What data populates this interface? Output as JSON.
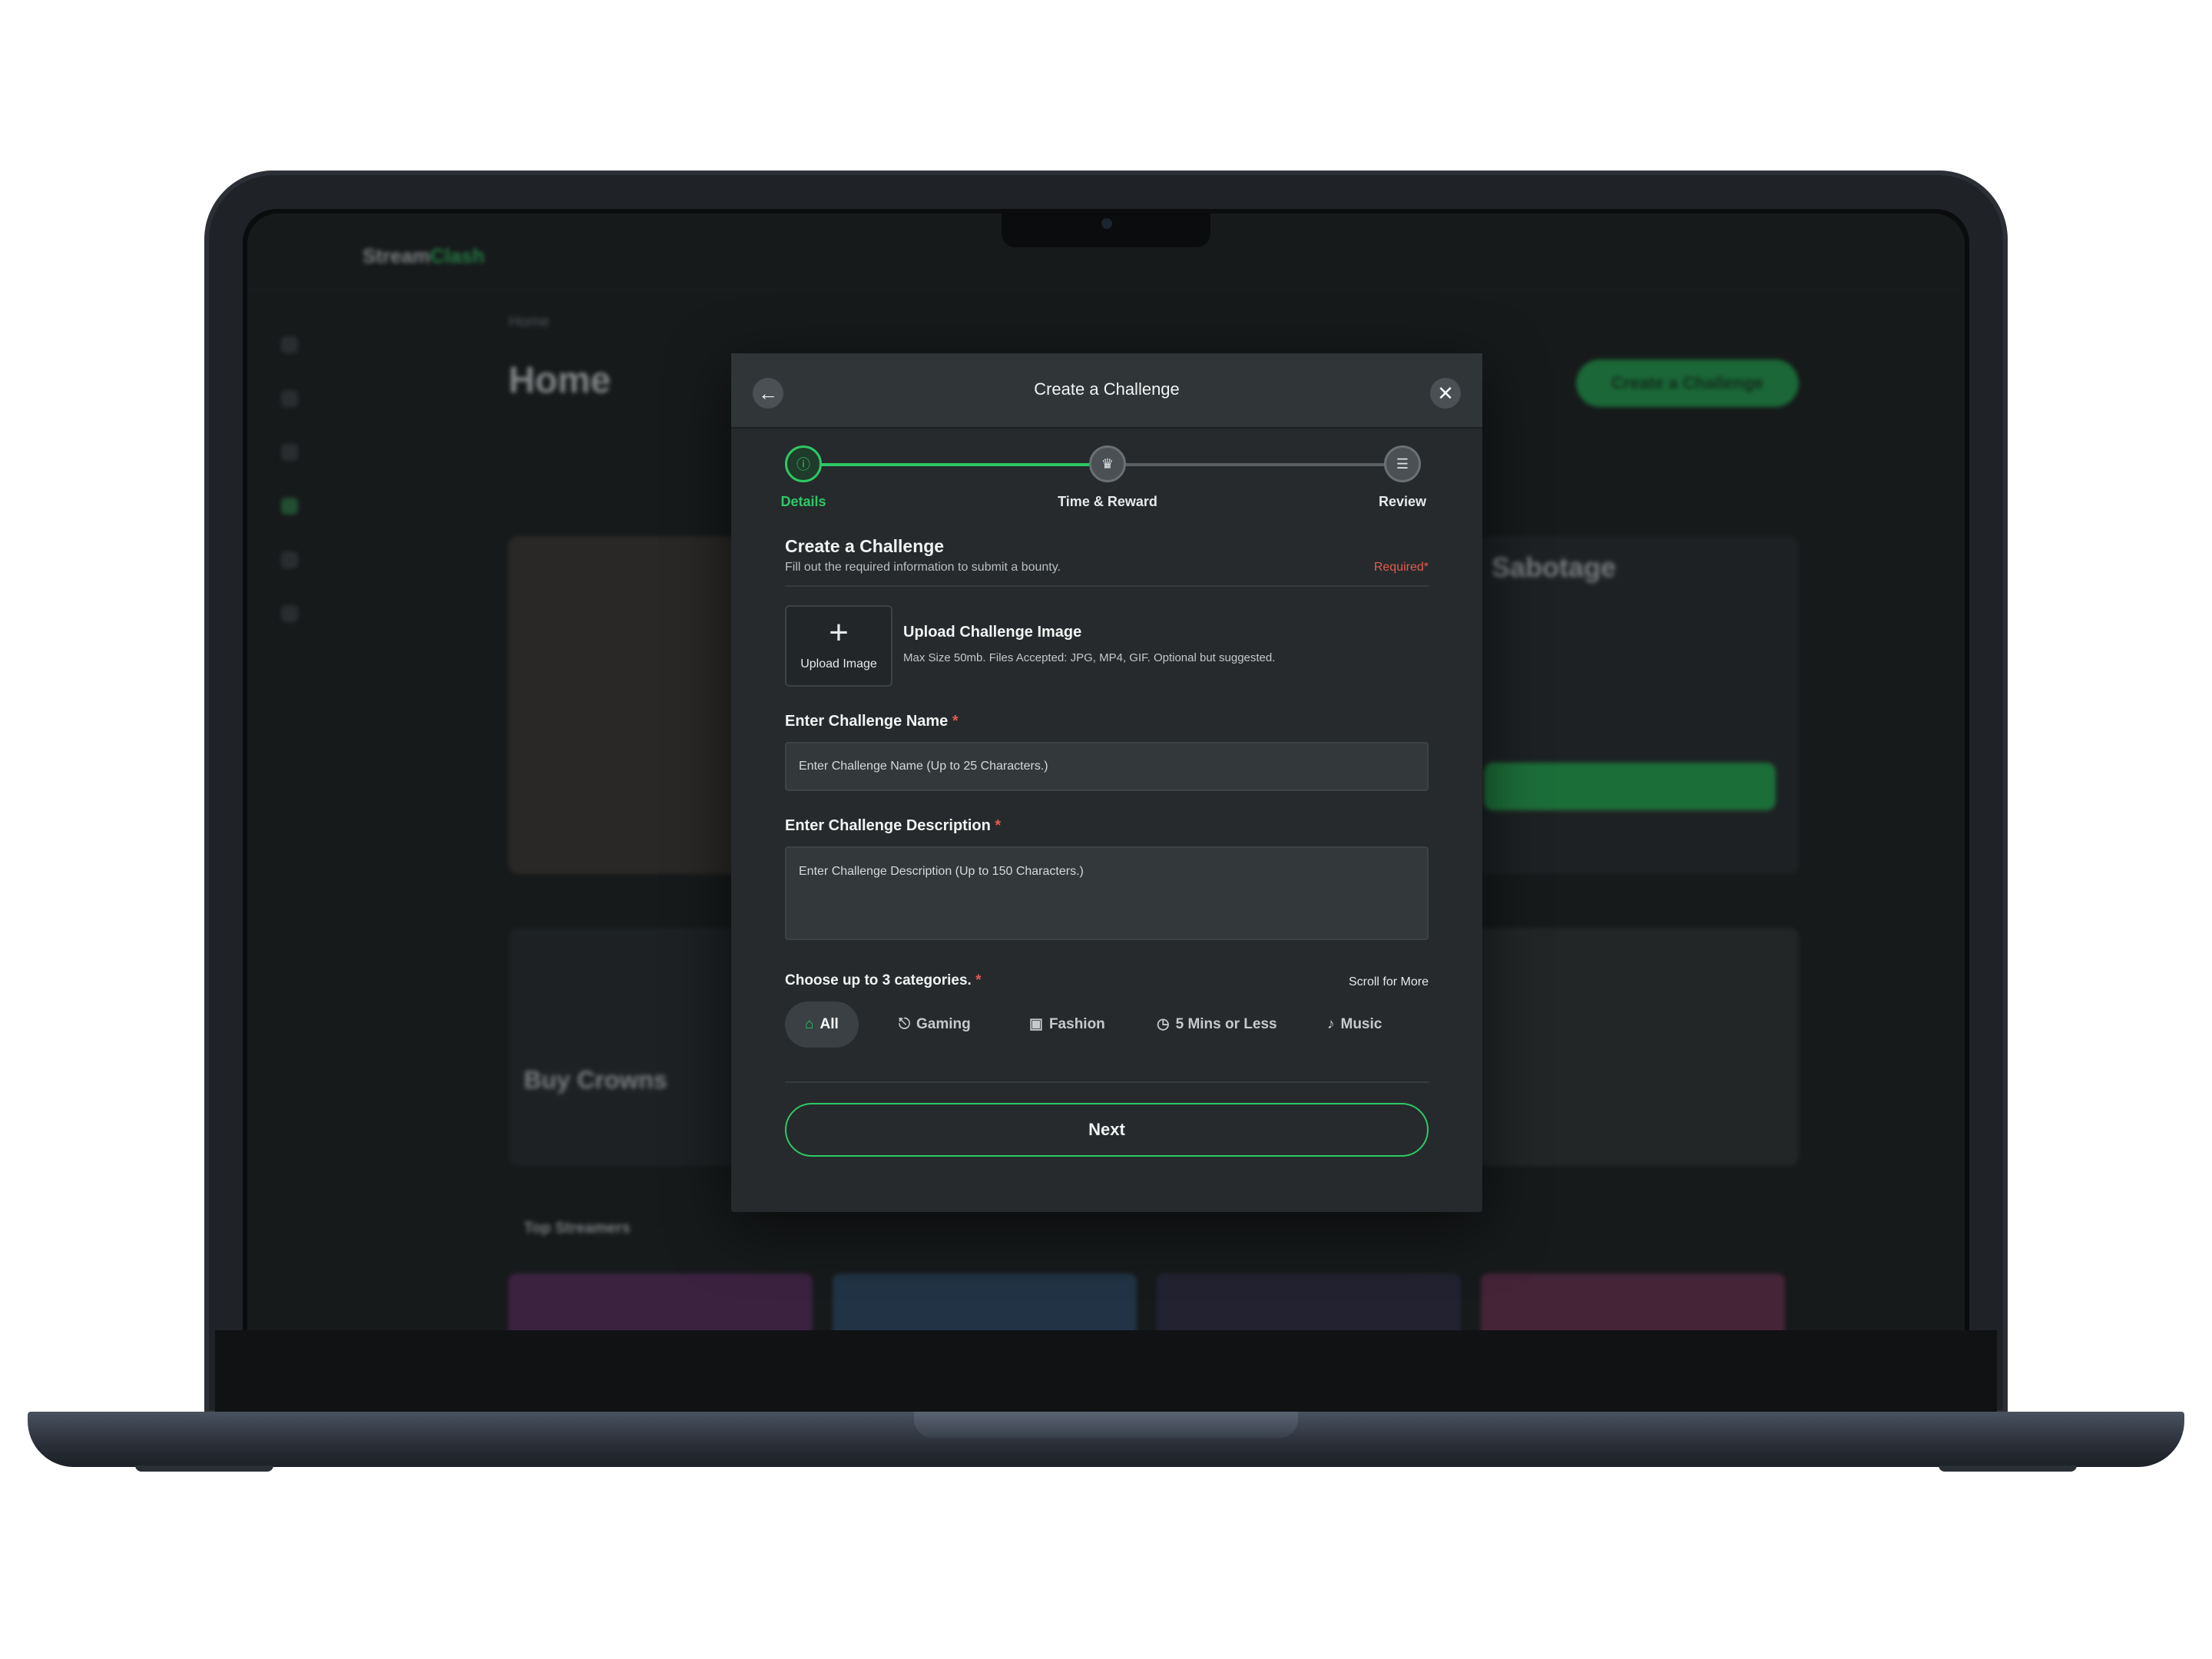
{
  "background_app": {
    "logo_prefix": "Stream",
    "logo_suffix": "Clash",
    "breadcrumb": "Home",
    "page_title": "Home",
    "create_button": "Create a Challenge",
    "featured_title": "Sabotage",
    "promo_title": "Buy Crowns",
    "section_top_streamers": "Top Streamers"
  },
  "modal": {
    "title": "Create a Challenge",
    "steps": [
      {
        "label": "Details",
        "state": "active"
      },
      {
        "label": "Time & Reward",
        "state": "inactive"
      },
      {
        "label": "Review",
        "state": "inactive"
      }
    ],
    "section_title": "Create a Challenge",
    "section_subtitle": "Fill out the required information to submit a bounty.",
    "required_note": "Required*",
    "upload": {
      "button_label": "Upload Image",
      "title": "Upload Challenge Image",
      "hint": "Max Size 50mb. Files Accepted: JPG, MP4, GIF. Optional but suggested."
    },
    "name_field": {
      "label": "Enter Challenge Name",
      "required_mark": "*",
      "placeholder": "Enter Challenge Name (Up to 25 Characters.)"
    },
    "description_field": {
      "label": "Enter Challenge Description",
      "required_mark": "*",
      "placeholder": "Enter Challenge Description (Up to 150 Characters.)"
    },
    "categories": {
      "label": "Choose up to 3 categories.",
      "required_mark": "*",
      "scroll_hint": "Scroll for More",
      "items": [
        {
          "label": "All",
          "icon": "home-icon",
          "active": true
        },
        {
          "label": "Gaming",
          "icon": "gamepad-icon",
          "active": false
        },
        {
          "label": "Fashion",
          "icon": "shirt-icon",
          "active": false
        },
        {
          "label": "5 Mins or Less",
          "icon": "timer-icon",
          "active": false
        },
        {
          "label": "Music",
          "icon": "music-note-icon",
          "active": false
        }
      ]
    },
    "next_button": "Next"
  },
  "colors": {
    "accent": "#2ec866",
    "required": "#e15b4f",
    "modal_bg": "#262a2c"
  }
}
